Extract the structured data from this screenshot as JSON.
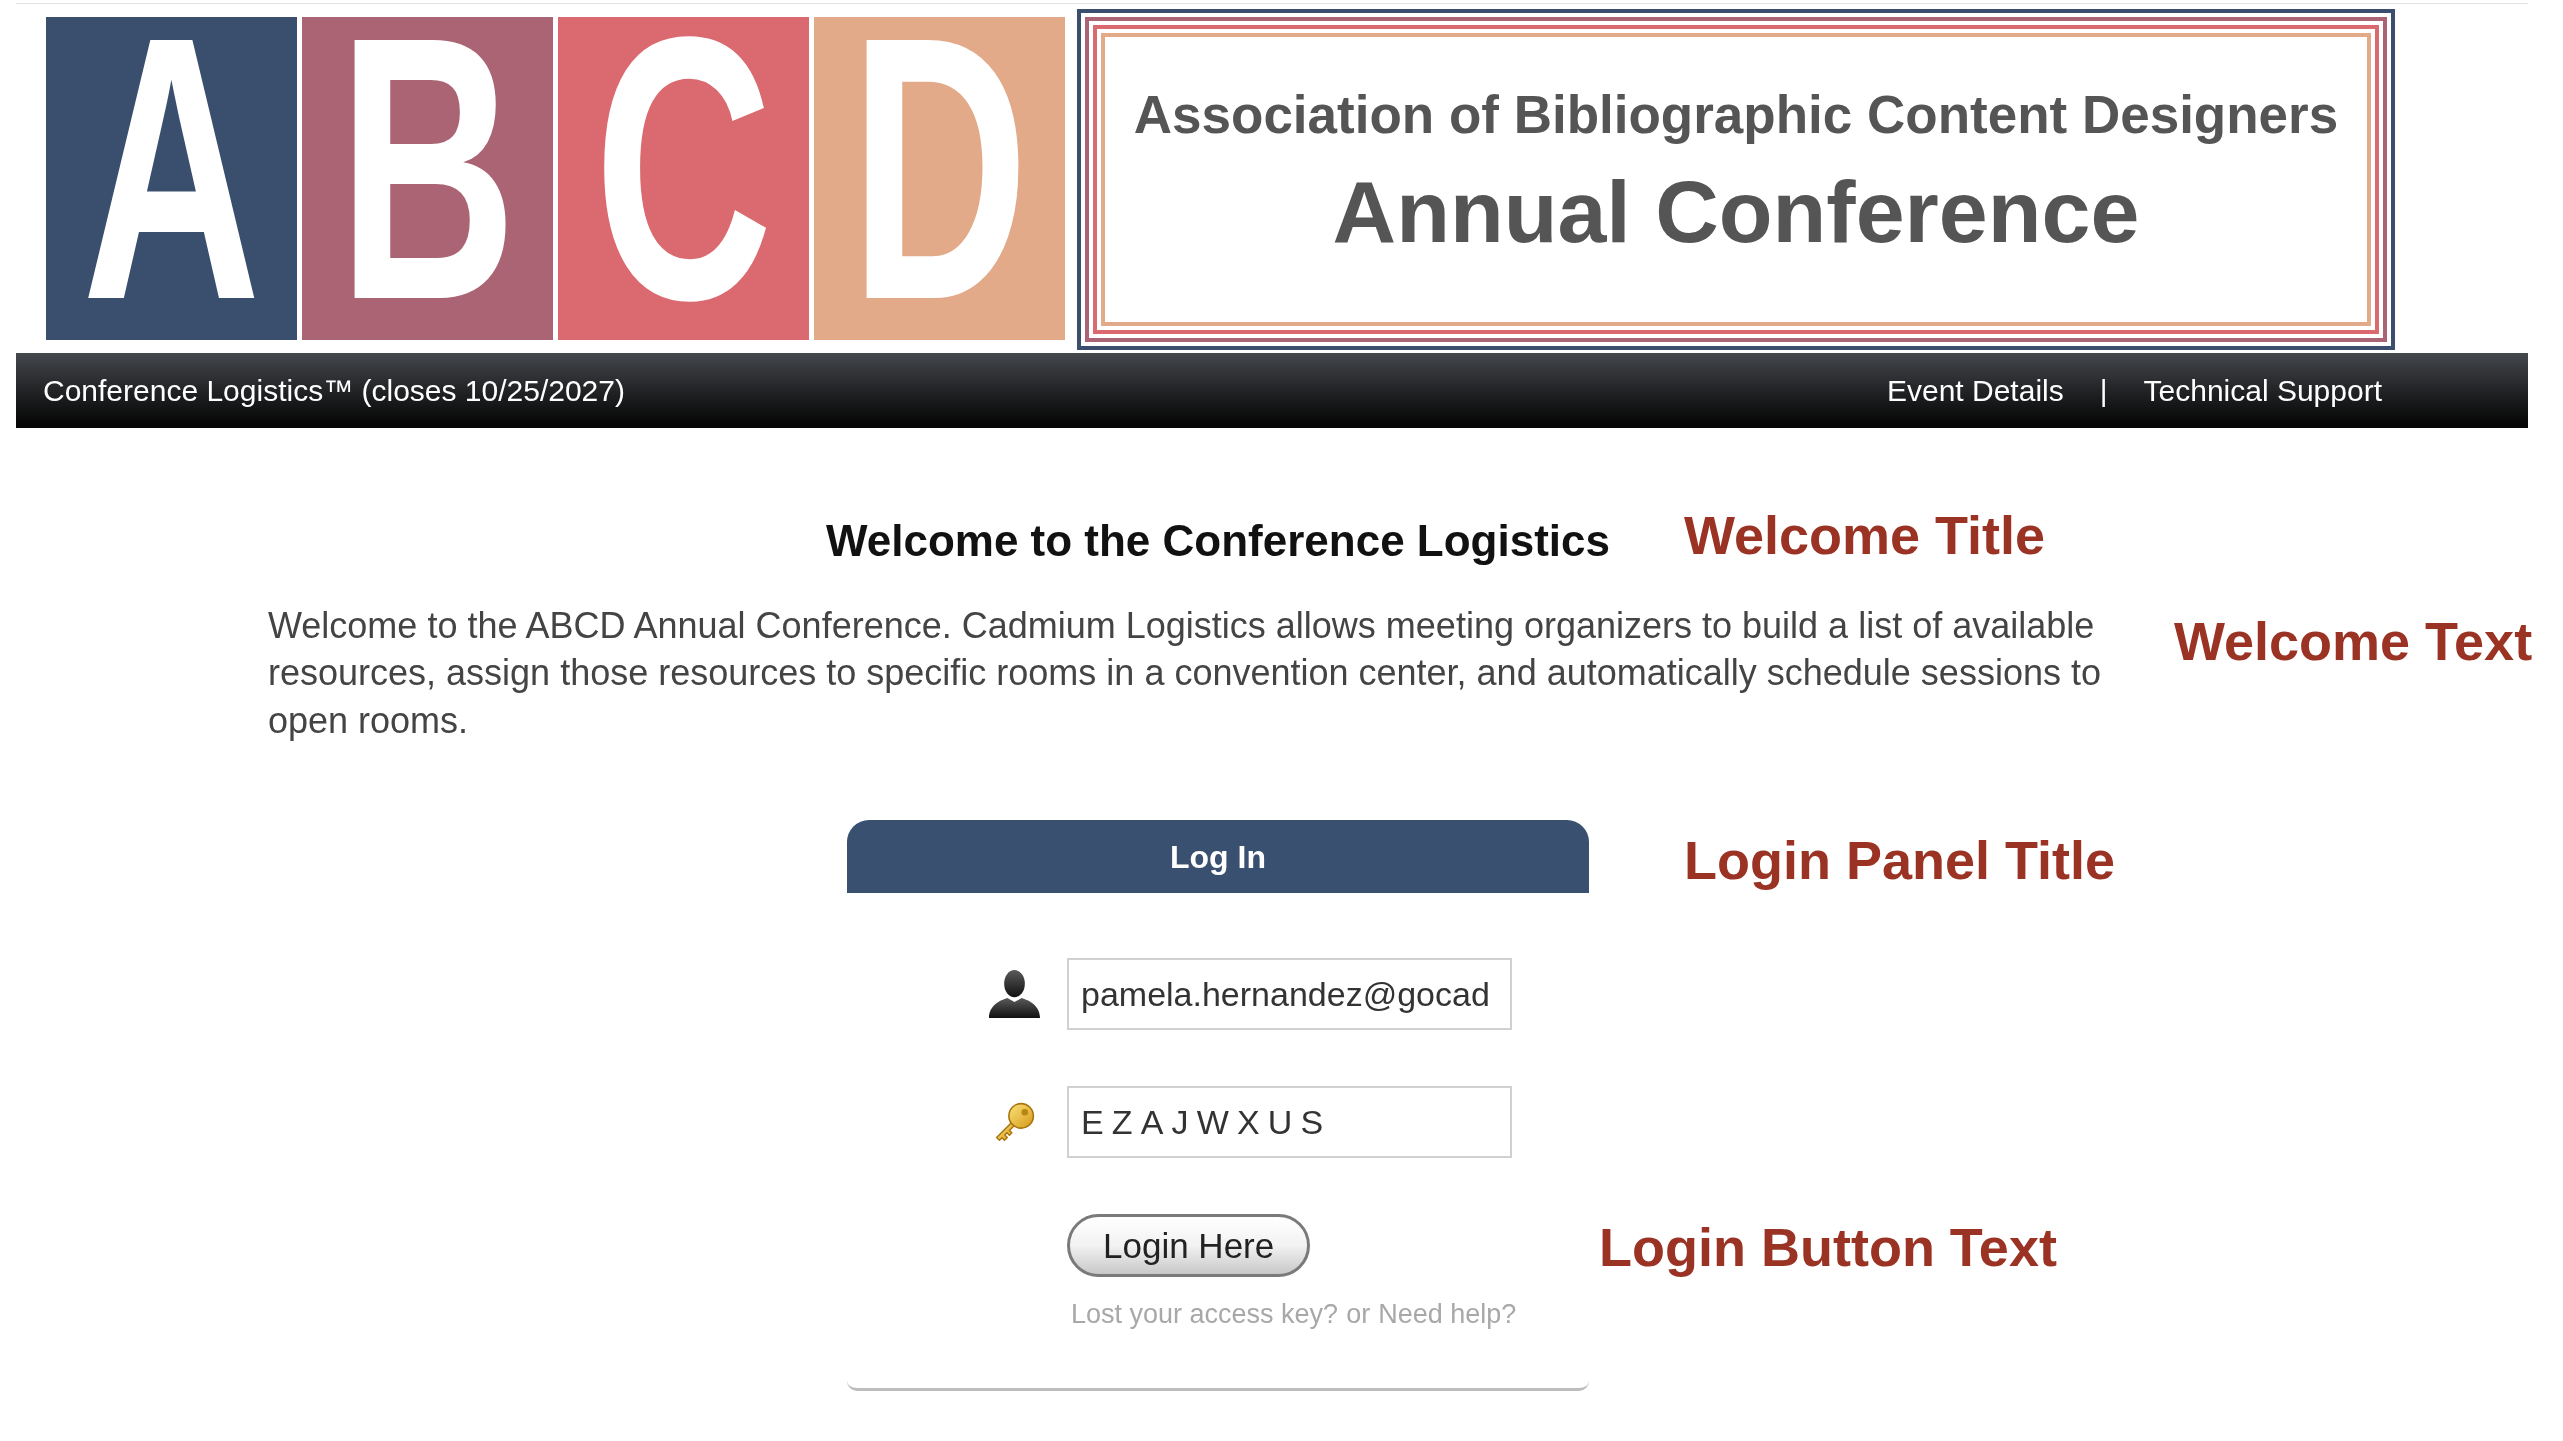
{
  "logo": {
    "letters": [
      {
        "char": "A",
        "color": "#3a4f6e"
      },
      {
        "char": "B",
        "color": "#ab6473"
      },
      {
        "char": "C",
        "color": "#da6a6f"
      },
      {
        "char": "D",
        "color": "#e2aa88"
      }
    ]
  },
  "banner": {
    "subtitle": "Association of Bibliographic Content Designers",
    "title": "Annual Conference"
  },
  "navbar": {
    "title": "Conference Logistics™ (closes 10/25/2027)",
    "links": [
      "Event Details",
      "Technical Support"
    ],
    "separator": "|"
  },
  "welcome": {
    "title": "Welcome to the Conference Logistics",
    "text": "Welcome to the ABCD Annual Conference. Cadmium Logistics allows meeting organizers to build a list of available resources, assign those resources to specific rooms in a convention center, and automatically schedule sessions to open rooms."
  },
  "login": {
    "title": "Log In",
    "fields": [
      {
        "kind": "user",
        "value": "pamela.hernandez@gocad"
      },
      {
        "kind": "key",
        "value": "EZAJWXUS"
      }
    ],
    "button": "Login Here",
    "help": {
      "links": [
        "Lost your access key?",
        "Need help?"
      ],
      "separator": "or"
    }
  },
  "annotations": [
    "Welcome Title",
    "Welcome Text",
    "Login Panel Title",
    "Login Button Text"
  ]
}
